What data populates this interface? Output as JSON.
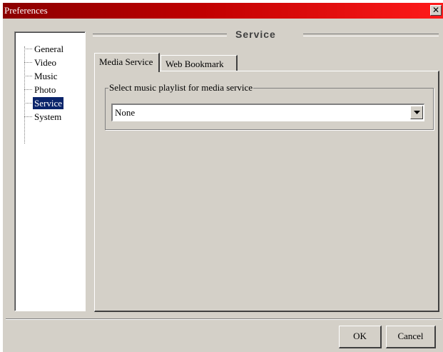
{
  "window": {
    "title": "Preferences",
    "close_glyph": "✕"
  },
  "tree": {
    "items": [
      {
        "label": "General",
        "selected": false
      },
      {
        "label": "Video",
        "selected": false
      },
      {
        "label": "Music",
        "selected": false
      },
      {
        "label": "Photo",
        "selected": false
      },
      {
        "label": "Service",
        "selected": true
      },
      {
        "label": "System",
        "selected": false
      }
    ]
  },
  "section": {
    "title": "Service"
  },
  "tabs": [
    {
      "label": "Media Service",
      "active": true
    },
    {
      "label": "Web Bookmark",
      "active": false
    }
  ],
  "media_service": {
    "group_label": "Select music playlist for media service",
    "playlist_select": {
      "value": "None"
    }
  },
  "buttons": {
    "ok": "OK",
    "cancel": "Cancel"
  },
  "colors": {
    "titlebar_start": "#8b0000",
    "titlebar_end": "#ff1a1a",
    "selection": "#0a246a",
    "face": "#d4d0c8"
  },
  "icons": {
    "close": "close-icon",
    "dropdown": "chevron-down-icon"
  }
}
